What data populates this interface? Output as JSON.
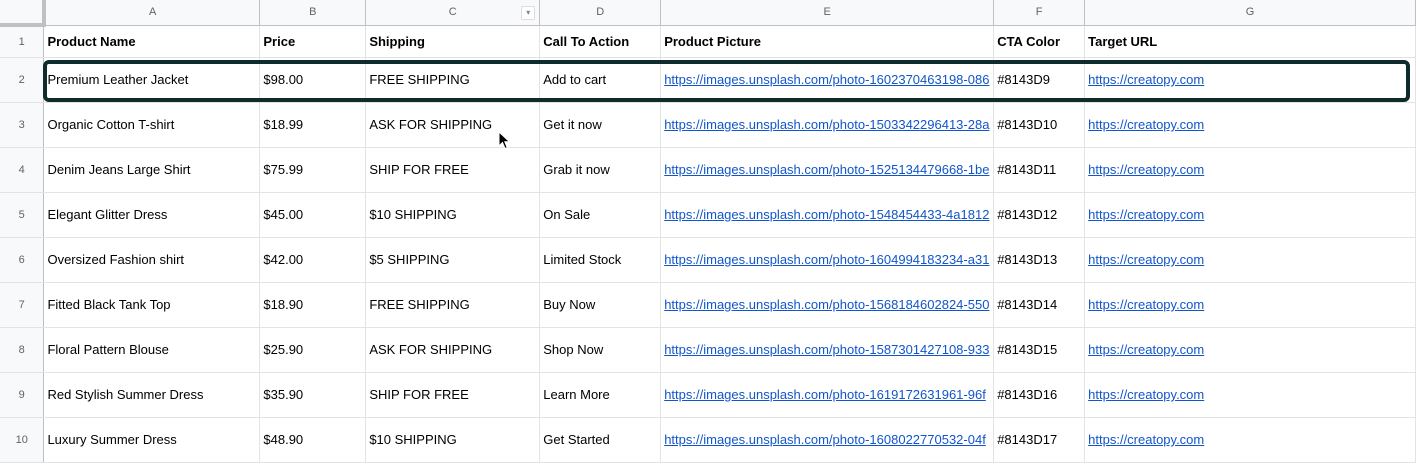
{
  "columns": [
    {
      "letter": "A"
    },
    {
      "letter": "B"
    },
    {
      "letter": "C"
    },
    {
      "letter": "D"
    },
    {
      "letter": "E"
    },
    {
      "letter": "F"
    },
    {
      "letter": "G"
    }
  ],
  "headers": {
    "product_name": "Product Name",
    "price": "Price",
    "shipping": "Shipping",
    "cta": "Call To Action",
    "picture": "Product Picture",
    "cta_color": "CTA Color",
    "target_url": "Target URL"
  },
  "rows": [
    {
      "num": "1"
    },
    {
      "num": "2",
      "name": "Premium Leather Jacket",
      "price": "$98.00",
      "shipping": "FREE SHIPPING",
      "cta": "Add to cart",
      "picture": "https://images.unsplash.com/photo-1602370463198-086",
      "color": "#8143D9",
      "url": "https://creatopy.com"
    },
    {
      "num": "3",
      "name": "Organic Cotton T-shirt",
      "price": "$18.99",
      "shipping": "ASK FOR SHIPPING",
      "cta": "Get it now",
      "picture": "https://images.unsplash.com/photo-1503342296413-28a",
      "color": "#8143D10",
      "url": "https://creatopy.com"
    },
    {
      "num": "4",
      "name": "Denim Jeans Large Shirt",
      "price": "$75.99",
      "shipping": "SHIP FOR FREE",
      "cta": "Grab it now",
      "picture": "https://images.unsplash.com/photo-1525134479668-1be",
      "color": "#8143D11",
      "url": "https://creatopy.com"
    },
    {
      "num": "5",
      "name": "Elegant Glitter Dress",
      "price": "$45.00",
      "shipping": "$10 SHIPPING",
      "cta": "On Sale",
      "picture": "https://images.unsplash.com/photo-1548454433-4a1812",
      "color": "#8143D12",
      "url": "https://creatopy.com"
    },
    {
      "num": "6",
      "name": "Oversized Fashion shirt",
      "price": "$42.00",
      "shipping": "$5 SHIPPING",
      "cta": "Limited Stock",
      "picture": "https://images.unsplash.com/photo-1604994183234-a31",
      "color": "#8143D13",
      "url": "https://creatopy.com"
    },
    {
      "num": "7",
      "name": "Fitted Black Tank Top",
      "price": "$18.90",
      "shipping": "FREE SHIPPING",
      "cta": "Buy Now",
      "picture": "https://images.unsplash.com/photo-1568184602824-550",
      "color": "#8143D14",
      "url": "https://creatopy.com"
    },
    {
      "num": "8",
      "name": "Floral Pattern Blouse",
      "price": "$25.90",
      "shipping": "ASK FOR SHIPPING",
      "cta": "Shop Now",
      "picture": "https://images.unsplash.com/photo-1587301427108-933",
      "color": "#8143D15",
      "url": "https://creatopy.com"
    },
    {
      "num": "9",
      "name": "Red Stylish Summer Dress",
      "price": "$35.90",
      "shipping": "SHIP FOR FREE",
      "cta": "Learn More",
      "picture": "https://images.unsplash.com/photo-1619172631961-96f",
      "color": "#8143D16",
      "url": "https://creatopy.com"
    },
    {
      "num": "10",
      "name": "Luxury Summer Dress",
      "price": "$48.90",
      "shipping": "$10 SHIPPING",
      "cta": "Get Started",
      "picture": "https://images.unsplash.com/photo-1608022770532-04f",
      "color": "#8143D17",
      "url": "https://creatopy.com"
    }
  ],
  "icons": {
    "filter": "filter-dropdown-icon",
    "cursor": "mouse-pointer-icon"
  },
  "colors": {
    "link": "#1155cc",
    "selection_border": "#0f2b2b",
    "header_bg": "#f8f9fa"
  }
}
